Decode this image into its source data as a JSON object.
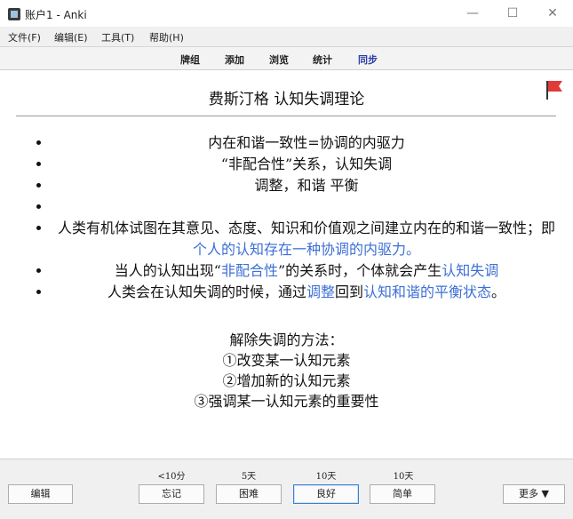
{
  "window": {
    "title": "账户1 - Anki",
    "minimize": "—",
    "maximize": "☐",
    "close": "✕"
  },
  "menu": [
    "文件(F)",
    "编辑(E)",
    "工具(T)",
    "帮助(H)"
  ],
  "toolbar": {
    "decks": "牌组",
    "add": "添加",
    "browse": "浏览",
    "stats": "统计",
    "sync": "同步"
  },
  "card": {
    "title": "费斯汀格 认知失调理论",
    "points": [
      {
        "text": "内在和谐一致性=协调的内驱力"
      },
      {
        "text": "“非配合性”关系，认知失调"
      },
      {
        "text": "调整，和谐 平衡"
      },
      {
        "text": ""
      },
      {
        "a": "人类有机体试图在其意见、态度、知识和价值观之间建立内在的和谐一致性；即",
        "b": "个人的认知存在一种协调的内驱力。"
      },
      {
        "a": "当人的认知出现“",
        "b": "非配合性",
        "c": "”的关系时，个体就会产生",
        "d": "认知失调"
      },
      {
        "a": "人类会在认知失调的时候，通过",
        "b": "调整",
        "c": "回到",
        "d": "认知和谐的平衡状态",
        "e": "。"
      }
    ],
    "method": {
      "heading": "解除失调的方法：",
      "items": [
        "①改变某一认知元素",
        "②增加新的认知元素",
        "③强调某一认知元素的重要性"
      ]
    },
    "flag_color": "#e03b3b"
  },
  "bottom": {
    "edit": "编辑",
    "intervals": {
      "again": "<10分",
      "hard": "5天",
      "good": "10天",
      "easy": "10天"
    },
    "buttons": {
      "again": "忘记",
      "hard": "困难",
      "good": "良好",
      "easy": "简单"
    },
    "more": "更多 ▼"
  },
  "colors": {
    "accent": "#3d6fd6",
    "sync": "#2b3fa8",
    "flag": "#e03b3b",
    "focus_border": "#3c7fd4"
  }
}
